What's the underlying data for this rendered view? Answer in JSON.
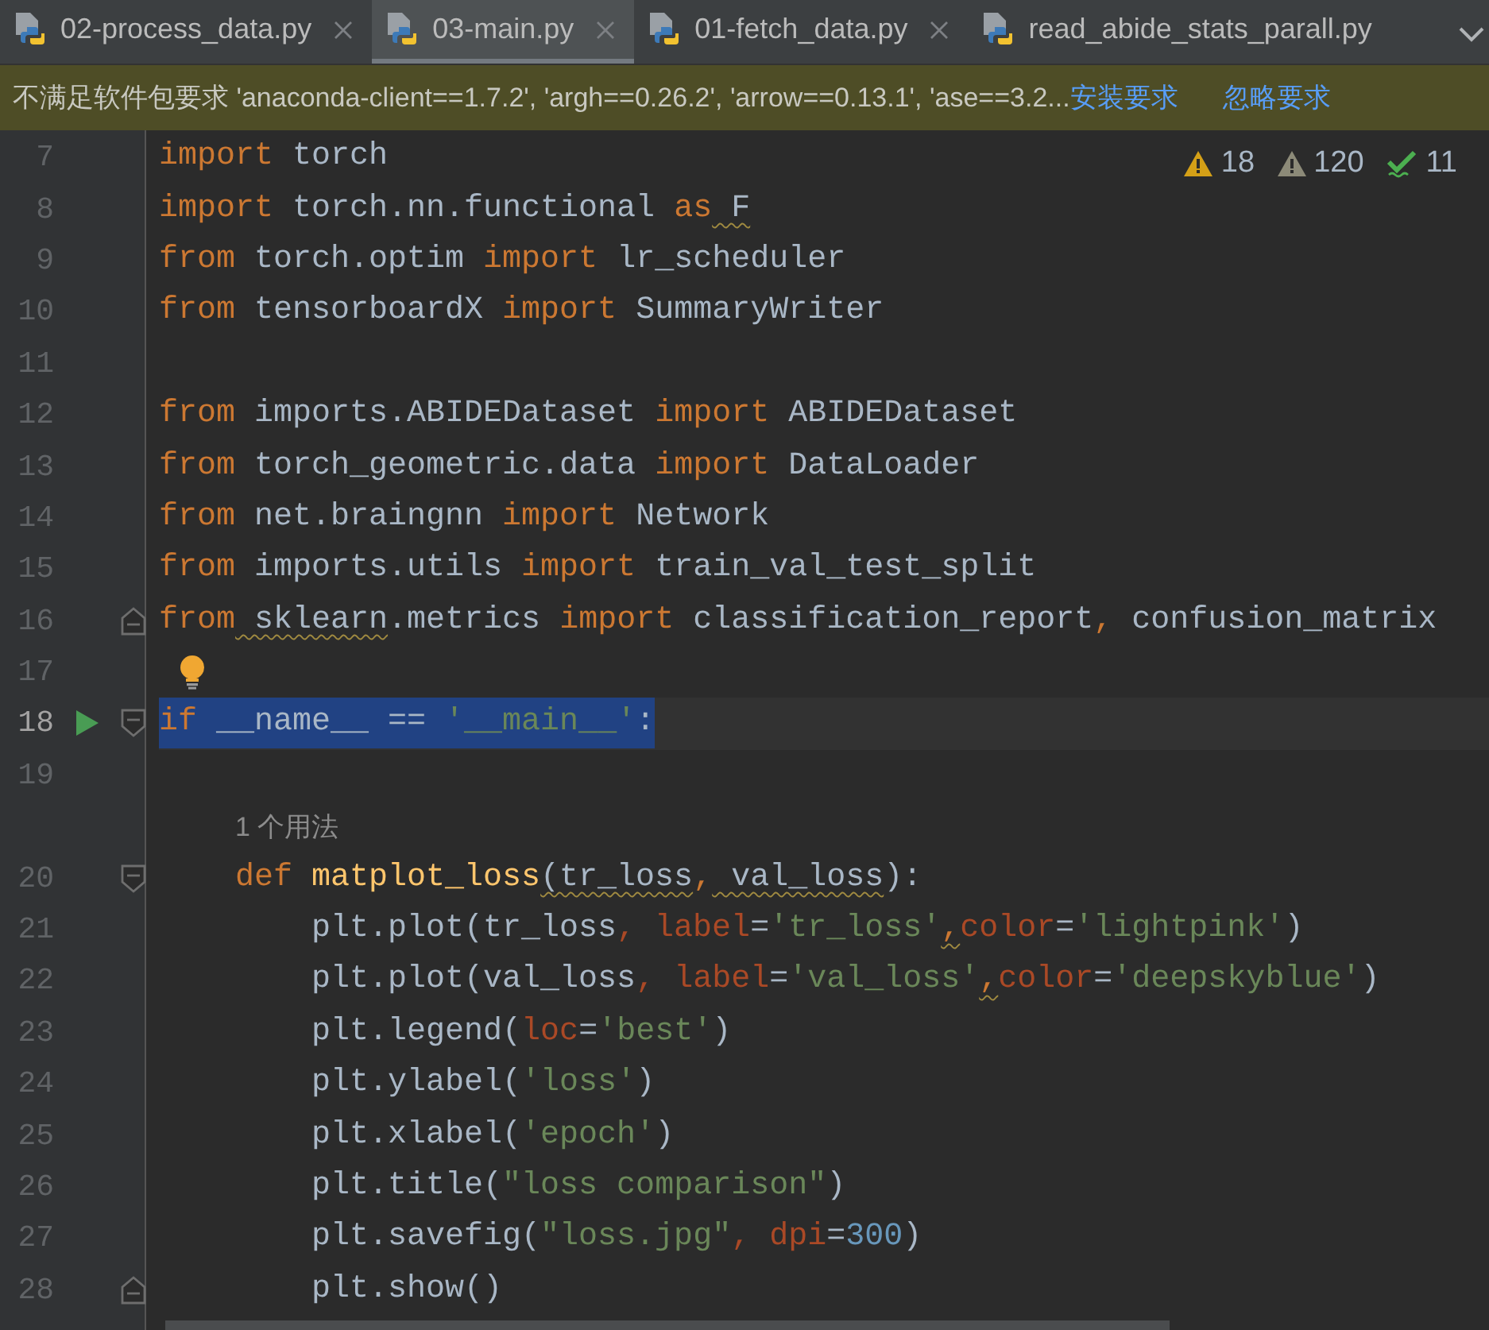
{
  "tabs": [
    {
      "label": "02-process_data.py",
      "selected": false,
      "closable": true
    },
    {
      "label": "03-main.py",
      "selected": true,
      "closable": true
    },
    {
      "label": "01-fetch_data.py",
      "selected": false,
      "closable": true
    },
    {
      "label": "read_abide_stats_parall.py",
      "selected": false,
      "closable": false
    }
  ],
  "notification": {
    "message": "不满足软件包要求 'anaconda-client==1.7.2', 'argh==0.26.2', 'arrow==0.13.1', 'ase==3.2...",
    "actions": [
      "安装要求",
      "忽略要求"
    ]
  },
  "inspections": [
    {
      "kind": "warning",
      "count": "18"
    },
    {
      "kind": "weak-warning",
      "count": "120"
    },
    {
      "kind": "typo",
      "count": "11"
    }
  ],
  "lines": [
    {
      "number": "7",
      "highlighted": false,
      "tokens": [
        {
          "text": "import",
          "kind": "kw"
        },
        {
          "text": " torch",
          "kind": "id"
        }
      ]
    },
    {
      "number": "8",
      "highlighted": false,
      "tokens": [
        {
          "text": "import",
          "kind": "kw"
        },
        {
          "text": " torch.nn.functional ",
          "kind": "id"
        },
        {
          "text": "as",
          "kind": "kw"
        },
        {
          "text": " F",
          "kind": "id",
          "warn": true
        }
      ]
    },
    {
      "number": "9",
      "highlighted": false,
      "tokens": [
        {
          "text": "from",
          "kind": "kw"
        },
        {
          "text": " torch.optim ",
          "kind": "id"
        },
        {
          "text": "import",
          "kind": "kw"
        },
        {
          "text": " lr_scheduler",
          "kind": "id"
        }
      ]
    },
    {
      "number": "10",
      "highlighted": false,
      "tokens": [
        {
          "text": "from",
          "kind": "kw"
        },
        {
          "text": " tensorboardX ",
          "kind": "id"
        },
        {
          "text": "import",
          "kind": "kw"
        },
        {
          "text": " SummaryWriter",
          "kind": "id"
        }
      ]
    },
    {
      "number": "11",
      "highlighted": false
    },
    {
      "number": "12",
      "highlighted": false,
      "tokens": [
        {
          "text": "from",
          "kind": "kw"
        },
        {
          "text": " imports.ABIDEDataset ",
          "kind": "id"
        },
        {
          "text": "import",
          "kind": "kw"
        },
        {
          "text": " ABIDEDataset",
          "kind": "id"
        }
      ]
    },
    {
      "number": "13",
      "highlighted": false,
      "tokens": [
        {
          "text": "from",
          "kind": "kw"
        },
        {
          "text": " torch_geometric.data ",
          "kind": "id"
        },
        {
          "text": "import",
          "kind": "kw"
        },
        {
          "text": " DataLoader",
          "kind": "id"
        }
      ]
    },
    {
      "number": "14",
      "highlighted": false,
      "tokens": [
        {
          "text": "from",
          "kind": "kw"
        },
        {
          "text": " net.braingnn ",
          "kind": "id"
        },
        {
          "text": "import",
          "kind": "kw"
        },
        {
          "text": " Network",
          "kind": "id"
        }
      ]
    },
    {
      "number": "15",
      "highlighted": false,
      "tokens": [
        {
          "text": "from",
          "kind": "kw"
        },
        {
          "text": " imports.utils ",
          "kind": "id"
        },
        {
          "text": "import",
          "kind": "kw"
        },
        {
          "text": " train_val_test_split",
          "kind": "id"
        }
      ]
    },
    {
      "number": "16",
      "highlighted": false,
      "fold_end": true,
      "tokens": [
        {
          "text": "from",
          "kind": "kw"
        },
        {
          "text": " sklearn",
          "kind": "id",
          "warn": true
        },
        {
          "text": ".metrics ",
          "kind": "id"
        },
        {
          "text": "import",
          "kind": "kw"
        },
        {
          "text": " classification_report",
          "kind": "id"
        },
        {
          "text": ",",
          "kind": "kw"
        },
        {
          "text": " confusion_matrix",
          "kind": "id"
        }
      ]
    },
    {
      "number": "17",
      "highlighted": false,
      "bulb": true
    },
    {
      "number": "18",
      "highlighted": true,
      "run": true,
      "fold_start": true,
      "tokens": [
        {
          "text": "if",
          "kind": "kw"
        },
        {
          "text": " __name__ == ",
          "kind": "id"
        },
        {
          "text": "'__main__'",
          "kind": "str"
        },
        {
          "text": ":",
          "kind": "id"
        }
      ]
    },
    {
      "number": "19",
      "highlighted": false
    },
    {
      "number": "20",
      "highlighted": false,
      "fold_start": true,
      "hint": "1 个用法",
      "tokens": [
        {
          "text": "    def",
          "kind": "kw"
        },
        {
          "text": " matplot_loss",
          "kind": "fn"
        },
        {
          "text": "(tr_loss",
          "kind": "id",
          "warn": true
        },
        {
          "text": ",",
          "kind": "kw"
        },
        {
          "text": " val_loss",
          "kind": "id",
          "warn": true
        },
        {
          "text": "):",
          "kind": "id"
        }
      ]
    },
    {
      "number": "21",
      "highlighted": false,
      "tokens": [
        {
          "text": "        plt.plot(tr_loss",
          "kind": "id"
        },
        {
          "text": ", label",
          "kind": "param"
        },
        {
          "text": "=",
          "kind": "id"
        },
        {
          "text": "'tr_loss'",
          "kind": "str"
        },
        {
          "text": ",",
          "kind": "kw",
          "warn": true
        },
        {
          "text": "color",
          "kind": "param"
        },
        {
          "text": "=",
          "kind": "id"
        },
        {
          "text": "'lightpink'",
          "kind": "str"
        },
        {
          "text": ")",
          "kind": "id"
        }
      ]
    },
    {
      "number": "22",
      "highlighted": false,
      "tokens": [
        {
          "text": "        plt.plot(val_loss",
          "kind": "id"
        },
        {
          "text": ", label",
          "kind": "param"
        },
        {
          "text": "=",
          "kind": "id"
        },
        {
          "text": "'val_loss'",
          "kind": "str"
        },
        {
          "text": ",",
          "kind": "kw",
          "warn": true
        },
        {
          "text": "color",
          "kind": "param"
        },
        {
          "text": "=",
          "kind": "id"
        },
        {
          "text": "'deepskyblue'",
          "kind": "str"
        },
        {
          "text": ")",
          "kind": "id"
        }
      ]
    },
    {
      "number": "23",
      "highlighted": false,
      "tokens": [
        {
          "text": "        plt.legend(",
          "kind": "id"
        },
        {
          "text": "loc",
          "kind": "param"
        },
        {
          "text": "=",
          "kind": "id"
        },
        {
          "text": "'best'",
          "kind": "str"
        },
        {
          "text": ")",
          "kind": "id"
        }
      ]
    },
    {
      "number": "24",
      "highlighted": false,
      "tokens": [
        {
          "text": "        plt.ylabel(",
          "kind": "id"
        },
        {
          "text": "'loss'",
          "kind": "str"
        },
        {
          "text": ")",
          "kind": "id"
        }
      ]
    },
    {
      "number": "25",
      "highlighted": false,
      "tokens": [
        {
          "text": "        plt.xlabel(",
          "kind": "id"
        },
        {
          "text": "'epoch'",
          "kind": "str"
        },
        {
          "text": ")",
          "kind": "id"
        }
      ]
    },
    {
      "number": "26",
      "highlighted": false,
      "tokens": [
        {
          "text": "        plt.title(",
          "kind": "id"
        },
        {
          "text": "\"loss comparison\"",
          "kind": "str"
        },
        {
          "text": ")",
          "kind": "id"
        }
      ]
    },
    {
      "number": "27",
      "highlighted": false,
      "tokens": [
        {
          "text": "        plt.savefig(",
          "kind": "id"
        },
        {
          "text": "\"loss.jpg\"",
          "kind": "str"
        },
        {
          "text": ", dpi",
          "kind": "param"
        },
        {
          "text": "=",
          "kind": "id"
        },
        {
          "text": "300",
          "kind": "num"
        },
        {
          "text": ")",
          "kind": "id"
        }
      ]
    },
    {
      "number": "28",
      "highlighted": false,
      "fold_end": true,
      "tokens": [
        {
          "text": "        plt.show()",
          "kind": "id"
        }
      ]
    }
  ]
}
